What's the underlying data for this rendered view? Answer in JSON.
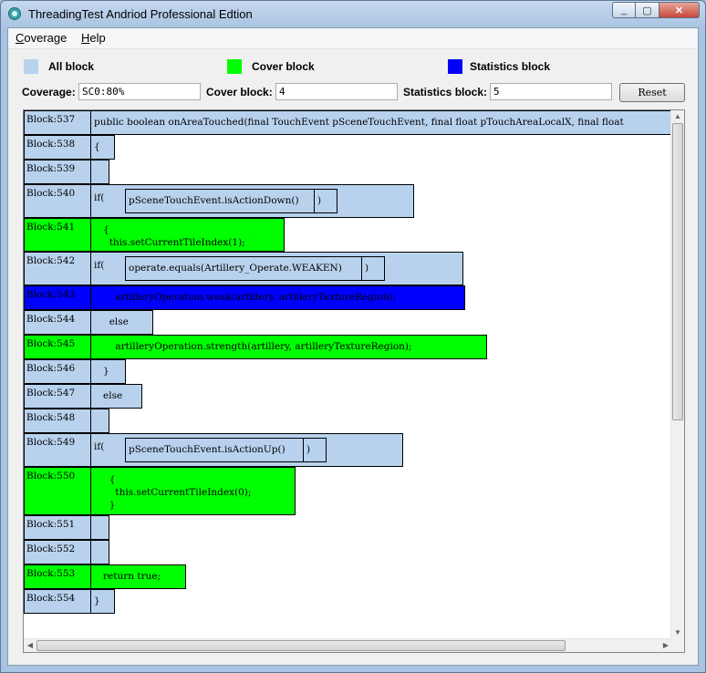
{
  "window": {
    "title": "ThreadingTest Andriod Professional Edtion",
    "min": "_",
    "max": "▢",
    "close": "✕"
  },
  "menu": [
    {
      "accel": "C",
      "rest": "overage"
    },
    {
      "accel": "H",
      "rest": "elp"
    }
  ],
  "legend": [
    {
      "label": "All block",
      "color": "#b8d2ee"
    },
    {
      "label": "Cover block",
      "color": "#00ff00"
    },
    {
      "label": "Statistics block",
      "color": "#0000ff"
    }
  ],
  "fields": {
    "coverage_label": "Coverage:",
    "coverage_value": "SC0:80%",
    "cover_block_label": "Cover block:",
    "cover_block_value": "4",
    "stats_block_label": "Statistics block:",
    "stats_block_value": "5",
    "reset": "Reset"
  },
  "blocks": [
    {
      "label": "Block:537",
      "type": "all",
      "lines": [
        "public boolean onAreaTouched(final TouchEvent pSceneTouchEvent, final float pTouchAreaLocalX, final float"
      ]
    },
    {
      "label": "Block:538",
      "type": "all",
      "lines": [
        "{"
      ]
    },
    {
      "label": "Block:539",
      "type": "all",
      "lines": [
        ""
      ]
    },
    {
      "label": "Block:540",
      "type": "all",
      "lines": [
        "if("
      ],
      "inner": "pSceneTouchEvent.isActionDown()",
      "close": ")"
    },
    {
      "label": "Block:541",
      "type": "cover",
      "lines": [
        "   {",
        "     this.setCurrentTileIndex(1);"
      ]
    },
    {
      "label": "Block:542",
      "type": "all",
      "lines": [
        "if("
      ],
      "inner": "operate.equals(Artillery_Operate.WEAKEN)",
      "close": ")"
    },
    {
      "label": "Block:543",
      "type": "stat",
      "lines": [
        "       artilleryOperation.weak(artillery, artilleryTextureRegion);"
      ]
    },
    {
      "label": "Block:544",
      "type": "all",
      "lines": [
        "     else"
      ]
    },
    {
      "label": "Block:545",
      "type": "cover",
      "lines": [
        "       artilleryOperation.strength(artillery, artilleryTextureRegion);"
      ]
    },
    {
      "label": "Block:546",
      "type": "all",
      "lines": [
        "   }"
      ]
    },
    {
      "label": "Block:547",
      "type": "all",
      "lines": [
        "   else"
      ]
    },
    {
      "label": "Block:548",
      "type": "all",
      "lines": [
        ""
      ]
    },
    {
      "label": "Block:549",
      "type": "all",
      "lines": [
        "if("
      ],
      "inner": "pSceneTouchEvent.isActionUp()",
      "close": ")"
    },
    {
      "label": "Block:550",
      "type": "cover",
      "lines": [
        "     {",
        "       this.setCurrentTileIndex(0);",
        "     }"
      ]
    },
    {
      "label": "Block:551",
      "type": "all",
      "lines": [
        ""
      ]
    },
    {
      "label": "Block:552",
      "type": "all",
      "lines": [
        ""
      ]
    },
    {
      "label": "Block:553",
      "type": "cover",
      "lines": [
        "   return true;"
      ]
    },
    {
      "label": "Block:554",
      "type": "all",
      "lines": [
        "}"
      ]
    }
  ],
  "scroll": {
    "v_up": "▲",
    "v_down": "▼",
    "h_left": "◀",
    "h_right": "▶"
  }
}
